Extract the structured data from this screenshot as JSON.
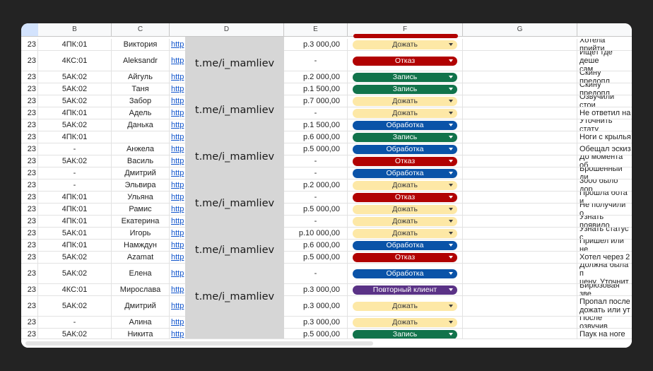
{
  "columns": [
    "B",
    "C",
    "D",
    "E",
    "F",
    "G"
  ],
  "overlay_text": "t.me/i_mamliev",
  "status_colors": {
    "Дожать": {
      "bg": "#fde8a6",
      "fg": "#3c3c3c",
      "style": "light"
    },
    "Отказ": {
      "bg": "#b10202",
      "fg": "#ffffff",
      "style": "dark"
    },
    "Запись": {
      "bg": "#11734b",
      "fg": "#ffffff",
      "style": "dark"
    },
    "Обработка": {
      "bg": "#0a53a8",
      "fg": "#ffffff",
      "style": "dark"
    },
    "Повторный клиент": {
      "bg": "#5a3286",
      "fg": "#ffffff",
      "style": "dark"
    }
  },
  "rows": [
    {
      "a": "23",
      "b": "4ПК:01",
      "c": "Виктория",
      "d": "http",
      "e": "р.3 000,00",
      "f": "Дожать",
      "h": [
        "Хотела прийти"
      ]
    },
    {
      "a": "23",
      "b": "4КС:01",
      "c": "Aleksandr",
      "d": "http",
      "e": "-",
      "f": "Отказ",
      "h": [
        "Ищет где деше",
        "сам"
      ]
    },
    {
      "a": "23",
      "b": "5АК:02",
      "c": "Айгуль",
      "d": "http",
      "e": "р.2 000,00",
      "f": "Запись",
      "h": [
        "Скину предопл"
      ]
    },
    {
      "a": "23",
      "b": "5АК:02",
      "c": "Таня",
      "d": "http",
      "e": "р.1 500,00",
      "f": "Запись",
      "h": [
        "Скину предопл"
      ]
    },
    {
      "a": "23",
      "b": "5АК:02",
      "c": "Забор",
      "d": "http",
      "e": "р.7 000,00",
      "f": "Дожать",
      "h": [
        "Озвучили стои"
      ]
    },
    {
      "a": "23",
      "b": "4ПК:01",
      "c": "Адель",
      "d": "http",
      "e": "-",
      "f": "Дожать",
      "h": [
        "Не ответил на"
      ]
    },
    {
      "a": "23",
      "b": "5АК:02",
      "c": "Данька",
      "d": "http",
      "e": "р.1 500,00",
      "f": "Обработка",
      "h": [
        "Уточнить стату"
      ]
    },
    {
      "a": "23",
      "b": "4ПК:01",
      "c": "",
      "d": "http",
      "e": "р.6 000,00",
      "f": "Запись",
      "h": [
        "Ноги с крылья"
      ]
    },
    {
      "a": "23",
      "b": "-",
      "c": "Анжела",
      "d": "http",
      "e": "р.5 000,00",
      "f": "Обработка",
      "h": [
        "Обещал эскиз"
      ]
    },
    {
      "a": "23",
      "b": "5АК:02",
      "c": "Василь",
      "d": "http",
      "e": "-",
      "f": "Отказ",
      "h": [
        "До момента об"
      ]
    },
    {
      "a": "23",
      "b": "-",
      "c": "Дмитрий",
      "d": "http",
      "e": "-",
      "f": "Обработка",
      "h": [
        "Брошенный ди"
      ]
    },
    {
      "a": "23",
      "b": "-",
      "c": "Эльвира",
      "d": "http",
      "e": "р.2 000,00",
      "f": "Дожать",
      "h": [
        "3000 было дор"
      ]
    },
    {
      "a": "23",
      "b": "4ПК:01",
      "c": "Ульяна",
      "d": "http",
      "e": "-",
      "f": "Отказ",
      "h": [
        "Прошла бота и"
      ]
    },
    {
      "a": "23",
      "b": "4ПК:01",
      "c": "Рамис",
      "d": "http",
      "e": "р.5 000,00",
      "f": "Дожать",
      "h": [
        "Не получили о"
      ]
    },
    {
      "a": "23",
      "b": "4ПК:01",
      "c": "Екатерина",
      "d": "http",
      "e": "-",
      "f": "Дожать",
      "h": [
        "Узнать появило"
      ]
    },
    {
      "a": "23",
      "b": "5АК:01",
      "c": "Игорь",
      "d": "http",
      "e": "р.10 000,00",
      "f": "Дожать",
      "h": [
        "Узнать статус с"
      ]
    },
    {
      "a": "23",
      "b": "4ПК:01",
      "c": "Намждун",
      "d": "http",
      "e": "р.6 000,00",
      "f": "Обработка",
      "h": [
        "Пришел или не"
      ]
    },
    {
      "a": "23",
      "b": "5АК:02",
      "c": "Azamat",
      "d": "http",
      "e": "р.5 000,00",
      "f": "Отказ",
      "h": [
        "Хотел через 2"
      ]
    },
    {
      "a": "23",
      "b": "5АК:02",
      "c": "Елена",
      "d": "http",
      "e": "-",
      "f": "Обработка",
      "h": [
        "Должна была п",
        "цену. Уточнит"
      ]
    },
    {
      "a": "23",
      "b": "4КС:01",
      "c": "Мирослава",
      "d": "http",
      "e": "р.3 000,00",
      "f": "Повторный клиент",
      "h": [
        "Бирюзовая зве"
      ]
    },
    {
      "a": "23",
      "b": "5АК:02",
      "c": "Дмитрий",
      "d": "http",
      "e": "р.3 000,00",
      "f": "Дожать",
      "h": [
        "Пропал после",
        "дожать или ут"
      ]
    },
    {
      "a": "23",
      "b": "-",
      "c": "Алина",
      "d": "http",
      "e": "р.3 000,00",
      "f": "Дожать",
      "h": [
        "После озвучив"
      ]
    },
    {
      "a": "23",
      "b": "5АК:02",
      "c": "Никита",
      "d": "http",
      "e": "р.5 000,00",
      "f": "Запись",
      "h": [
        "Паук на ноге"
      ]
    }
  ]
}
